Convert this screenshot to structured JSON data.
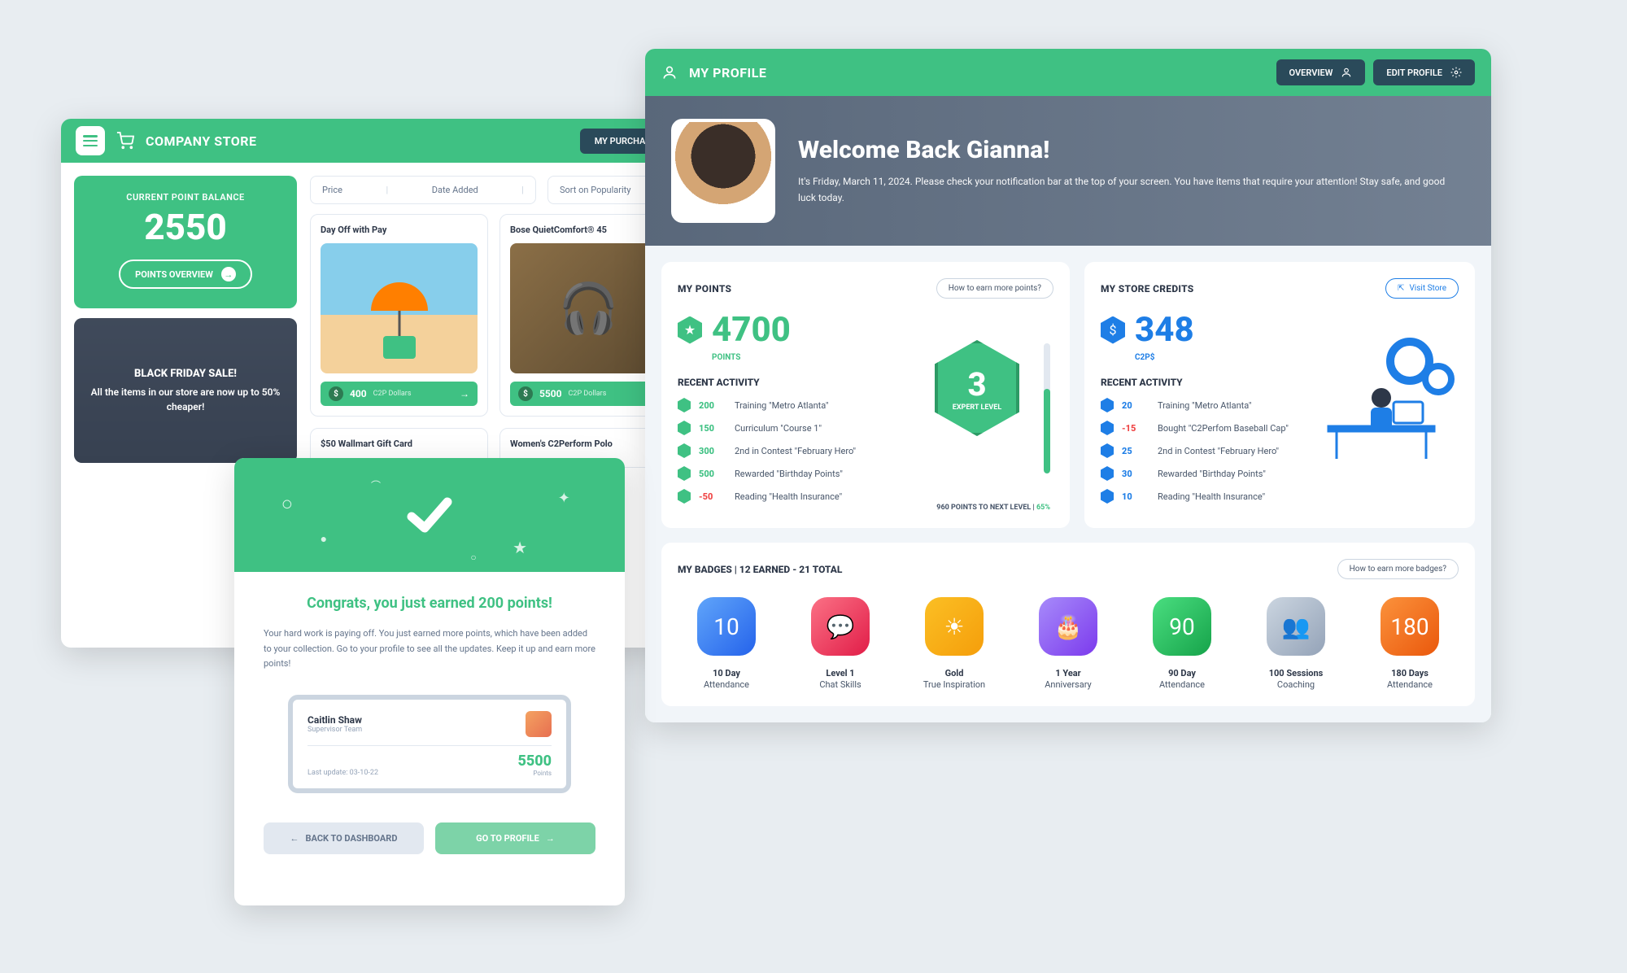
{
  "store": {
    "title": "COMPANY STORE",
    "my_purchases": "MY PURCHASES",
    "balance_label": "CURRENT POINT BALANCE",
    "balance_value": "2550",
    "overview_btn": "POINTS OVERVIEW",
    "promo_title": "BLACK FRIDAY SALE!",
    "promo_sub": "All the items in our store are now up to 50% cheaper!",
    "filters": {
      "price": "Price",
      "date_added": "Date Added",
      "sort": "Sort on Popularity"
    },
    "products": [
      {
        "name": "Day Off with Pay",
        "price": "400",
        "unit": "C2P Dollars"
      },
      {
        "name": "Bose QuietComfort® 45",
        "price": "5500",
        "unit": "C2P Dollars"
      },
      {
        "name": "$50 Wallmart Gift Card",
        "price": "",
        "unit": ""
      },
      {
        "name": "Women's C2Perform Polo",
        "price": "",
        "unit": ""
      }
    ]
  },
  "congrats": {
    "title": "Congrats, you just earned 200 points!",
    "text": "Your hard work is paying off. You just earned more points, which have been added to your collection. Go to your profile to see all the updates. Keep it up and earn more points!",
    "user_name": "Caitlin Shaw",
    "user_role": "Supervisor Team",
    "last_update": "Last update: 03-10-22",
    "user_points": "5500",
    "user_points_label": "Points",
    "back_btn": "BACK TO DASHBOARD",
    "goto_btn": "GO TO PROFILE"
  },
  "profile": {
    "title": "MY PROFILE",
    "overview_btn": "OVERVIEW",
    "edit_btn": "EDIT PROFILE",
    "welcome_title": "Welcome Back Gianna!",
    "welcome_sub": "It's Friday, March 11, 2024. Please check your notification bar at the top of your screen. You have items that require your attention! Stay safe, and good luck today.",
    "points": {
      "title": "MY POINTS",
      "link": "How to earn more points?",
      "value": "4700",
      "label": "POINTS",
      "recent_title": "RECENT ACTIVITY",
      "activity": [
        {
          "num": "200",
          "desc": "Training \"Metro Atlanta\""
        },
        {
          "num": "150",
          "desc": "Curriculum \"Course 1\""
        },
        {
          "num": "300",
          "desc": "2nd in Contest \"February Hero\""
        },
        {
          "num": "500",
          "desc": "Rewarded \"Birthday Points\""
        },
        {
          "num": "-50",
          "desc": "Reading \"Health Insurance\""
        }
      ],
      "level_num": "3",
      "level_txt": "EXPERT LEVEL",
      "progress_text": "960 POINTS TO NEXT LEVEL | ",
      "progress_pct": "65%"
    },
    "credits": {
      "title": "MY STORE CREDITS",
      "link": "Visit Store",
      "value": "348",
      "label": "C2P$",
      "recent_title": "RECENT ACTIVITY",
      "activity": [
        {
          "num": "20",
          "desc": "Training \"Metro Atlanta\""
        },
        {
          "num": "-15",
          "desc": "Bought \"C2Perfom Baseball Cap\""
        },
        {
          "num": "25",
          "desc": "2nd in Contest \"February Hero\""
        },
        {
          "num": "30",
          "desc": "Rewarded \"Birthday Points\""
        },
        {
          "num": "10",
          "desc": "Reading \"Health Insurance\""
        }
      ]
    },
    "badges": {
      "title": "MY BADGES | 12 EARNED - 21 TOTAL",
      "link": "How to earn more badges?",
      "items": [
        {
          "name": "10 Day",
          "sub": "Attendance",
          "color": "linear-gradient(135deg,#60a5fa,#2563eb)",
          "glyph": "10"
        },
        {
          "name": "Level 1",
          "sub": "Chat Skills",
          "color": "linear-gradient(135deg,#fb7185,#e11d48)",
          "glyph": "💬"
        },
        {
          "name": "Gold",
          "sub": "True Inspiration",
          "color": "linear-gradient(135deg,#fbbf24,#f59e0b)",
          "glyph": "☀"
        },
        {
          "name": "1 Year",
          "sub": "Anniversary",
          "color": "linear-gradient(135deg,#a78bfa,#7c3aed)",
          "glyph": "🎂"
        },
        {
          "name": "90 Day",
          "sub": "Attendance",
          "color": "linear-gradient(135deg,#4ade80,#16a34a)",
          "glyph": "90"
        },
        {
          "name": "100 Sessions",
          "sub": "Coaching",
          "color": "linear-gradient(135deg,#cbd5e0,#94a3b8)",
          "glyph": "👥"
        },
        {
          "name": "180 Days",
          "sub": "Attendance",
          "color": "linear-gradient(135deg,#fb923c,#ea580c)",
          "glyph": "180"
        }
      ]
    }
  }
}
